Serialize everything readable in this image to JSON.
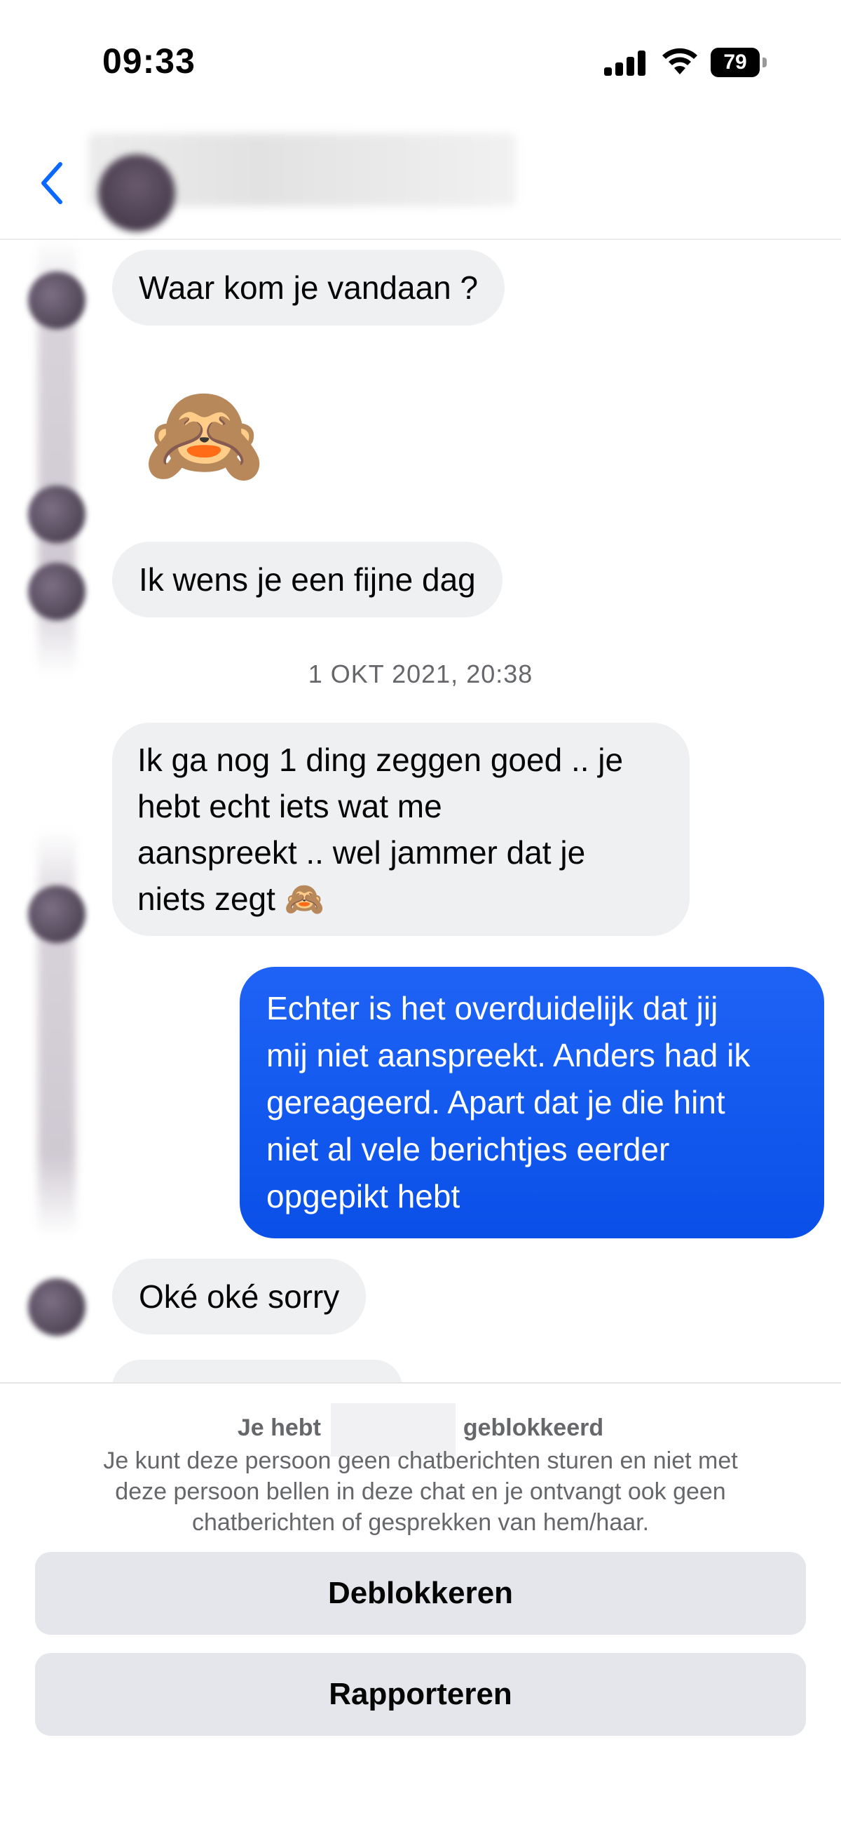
{
  "status_bar": {
    "time": "09:33",
    "battery": "79",
    "icons": [
      "signal-icon",
      "wifi-icon",
      "battery-icon"
    ]
  },
  "header": {
    "back_icon": "chevron-left-icon",
    "accent_color": "#0a68ff"
  },
  "messages": [
    {
      "direction": "incoming",
      "text": "Waar kom je vandaan ?"
    },
    {
      "direction": "incoming",
      "type": "emoji",
      "text": "🙈"
    },
    {
      "direction": "incoming",
      "text": "Ik wens je een fijne dag"
    },
    {
      "type": "timestamp",
      "text": "1 OKT 2021, 20:38"
    },
    {
      "direction": "incoming",
      "lines": [
        "Ik ga nog 1 ding zeggen goed .. je",
        "hebt echt iets wat me",
        "aanspreekt .. wel jammer dat je",
        "niets zegt 🙈"
      ]
    },
    {
      "direction": "outgoing",
      "lines": [
        "Echter is het overduidelijk dat jij",
        "mij niet aanspreekt. Anders had ik",
        "gereageerd. Apart dat je die hint",
        "niet al vele berichtjes eerder",
        "opgepikt hebt"
      ]
    },
    {
      "direction": "incoming",
      "text": "Oké oké sorry"
    }
  ],
  "block_panel": {
    "title_prefix": "Je hebt",
    "title_suffix": "geblokkeerd",
    "description_lines": [
      "Je kunt deze persoon geen chatberichten sturen en niet met",
      "deze persoon bellen in deze chat en je ontvangt ook geen",
      "chatberichten of gesprekken van hem/haar."
    ],
    "unblock_label": "Deblokkeren",
    "report_label": "Rapporteren"
  },
  "colors": {
    "outgoing_bubble": "#0a50e8",
    "incoming_bubble": "#eff0f2",
    "button_bg": "#e4e6eb",
    "secondary_text": "#65676b"
  }
}
